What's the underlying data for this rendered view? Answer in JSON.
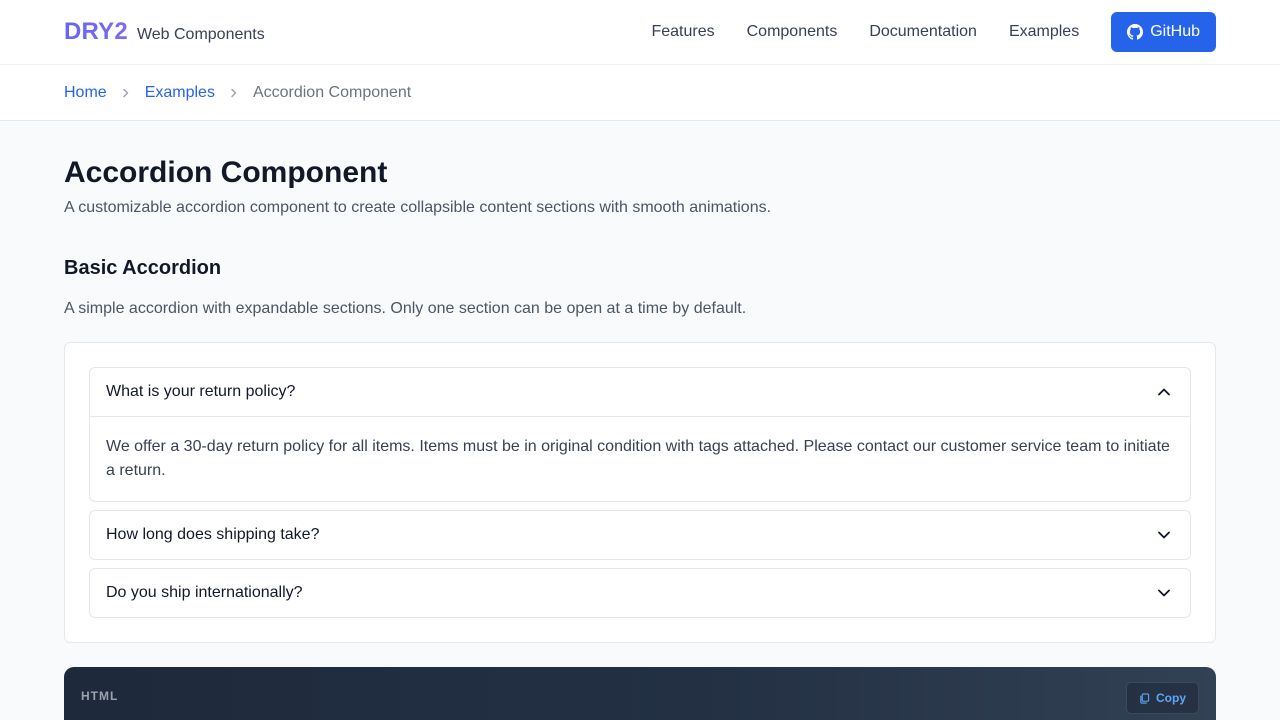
{
  "header": {
    "brand_logo": "DRY2",
    "brand_sub": "Web Components",
    "nav": [
      "Features",
      "Components",
      "Documentation",
      "Examples"
    ],
    "github_label": "GitHub",
    "github_icon": "github-icon"
  },
  "breadcrumb": {
    "items": [
      "Home",
      "Examples"
    ],
    "current": "Accordion Component",
    "separator_icon": "chevron-right-icon"
  },
  "page": {
    "title": "Accordion Component",
    "lead": "A customizable accordion component to create collapsible content sections with smooth animations."
  },
  "section": {
    "title": "Basic Accordion",
    "description": "A simple accordion with expandable sections. Only one section can be open at a time by default."
  },
  "accordion": {
    "items": [
      {
        "question": "What is your return policy?",
        "answer": "We offer a 30-day return policy for all items. Items must be in original condition with tags attached. Please contact our customer service team to initiate a return.",
        "expanded": true,
        "icon": "chevron-up-icon"
      },
      {
        "question": "How long does shipping take?",
        "expanded": false,
        "icon": "chevron-down-icon"
      },
      {
        "question": "Do you ship internationally?",
        "expanded": false,
        "icon": "chevron-down-icon"
      }
    ]
  },
  "code": {
    "language": "HTML",
    "copy_label": "Copy",
    "copy_icon": "copy-icon"
  },
  "colors": {
    "accent": "#2563eb",
    "brand": "#6366f1",
    "code_bg": "#1e293b"
  }
}
